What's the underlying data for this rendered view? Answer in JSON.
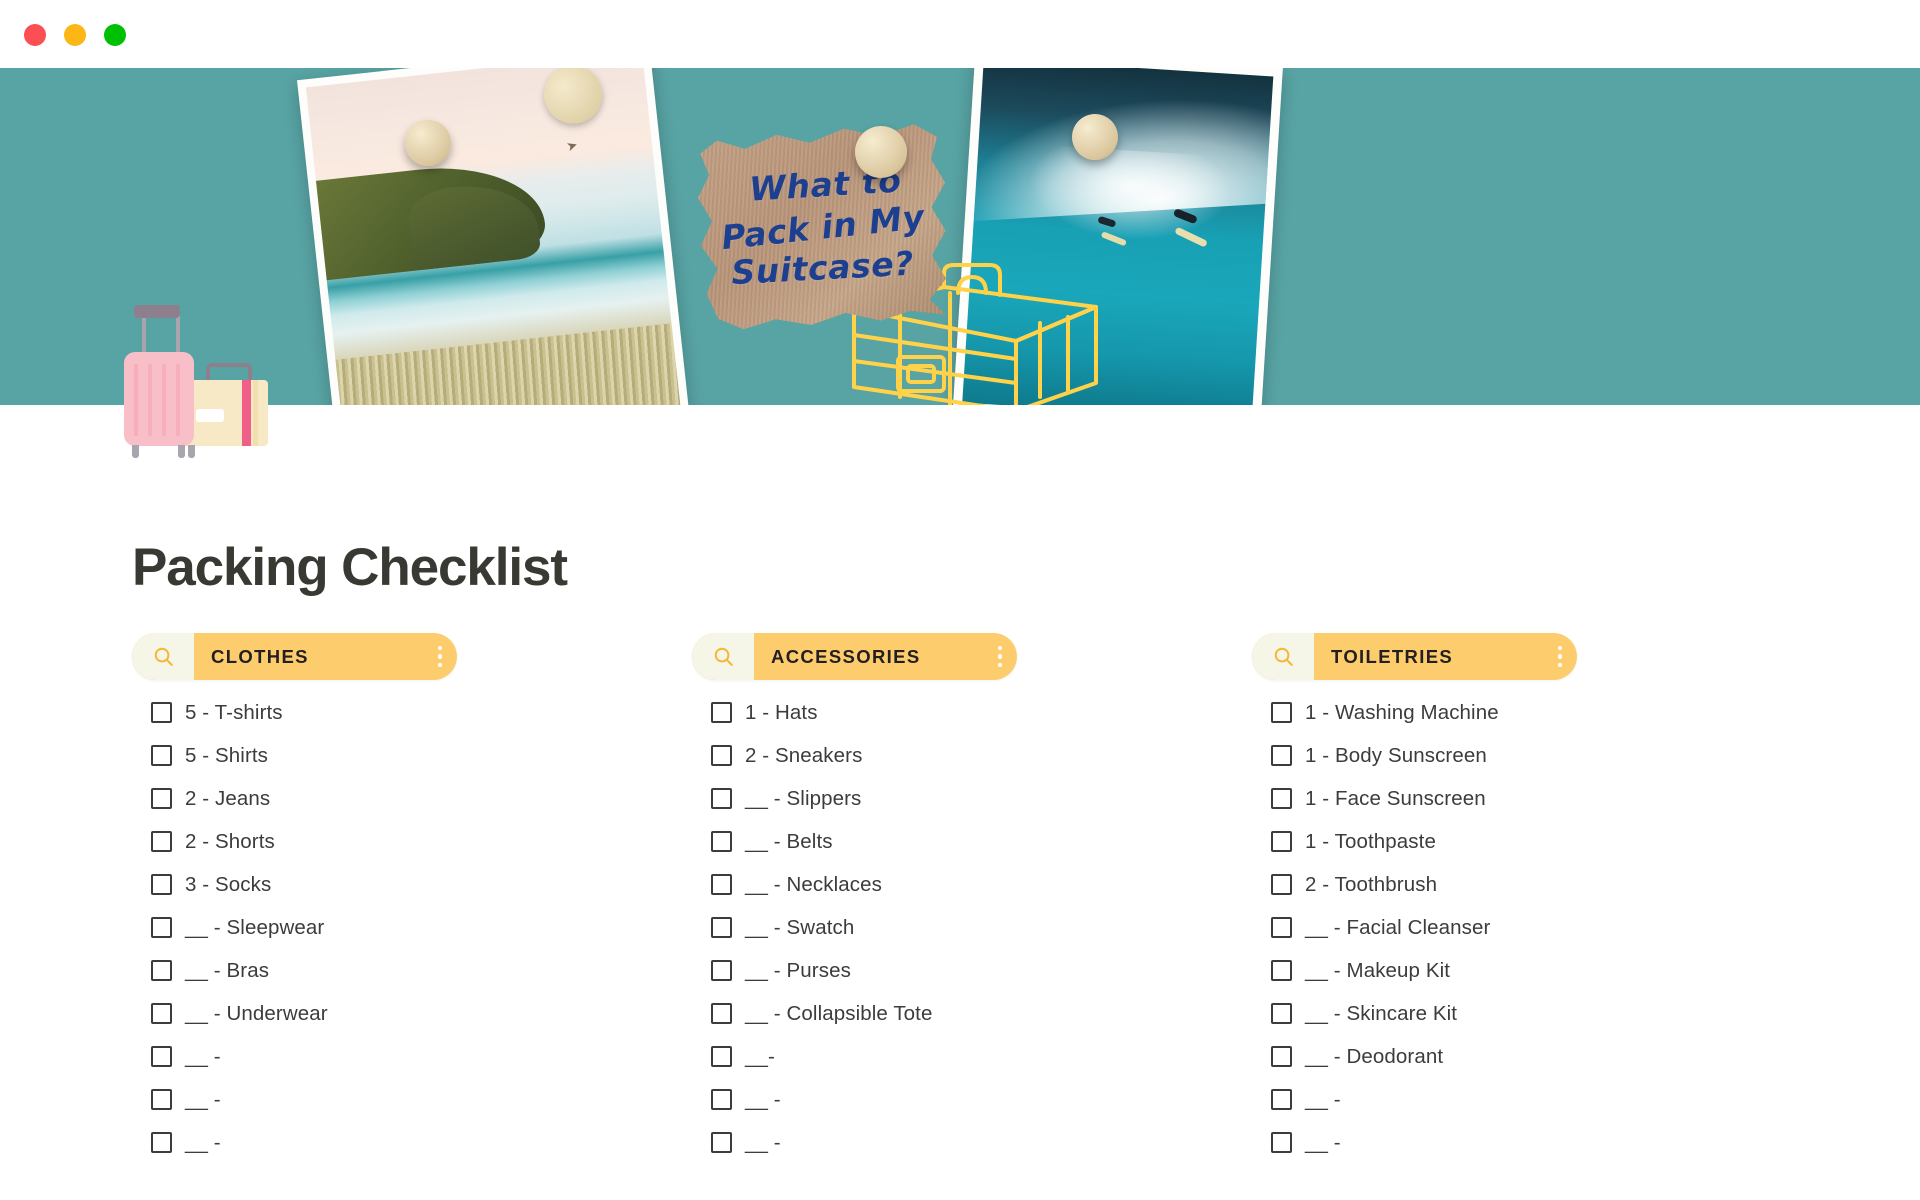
{
  "window": {
    "traffic_lights": [
      {
        "name": "close",
        "color": "#fc4f53"
      },
      {
        "name": "minimize",
        "color": "#fcb616"
      },
      {
        "name": "zoom",
        "color": "#01c001"
      }
    ]
  },
  "hero": {
    "background_color": "#58a3a4",
    "note_lines": [
      "What to",
      "Pack in My",
      "Suitcase?"
    ],
    "note_text": "What to Pack in My Suitcase?",
    "note_text_color": "#1c3f8f",
    "images": [
      {
        "name": "beach-photo",
        "description": "Coastal beach at sunset with headland"
      },
      {
        "name": "surf-photo",
        "description": "Surfers riding a large blue wave"
      }
    ],
    "illustrations": [
      "pink-suitcase",
      "cream-suitcase",
      "yellow-line-art-suitcase"
    ]
  },
  "page": {
    "title": "Packing Checklist",
    "title_color": "#393933"
  },
  "columns": [
    {
      "title": "Clothes",
      "accent_color": "#fdcd6d",
      "search_icon": "search-icon",
      "menu_icon": "kebab-menu-icon",
      "items": [
        {
          "qty": "5",
          "name": "T-shirts",
          "text": "5 - T-shirts",
          "checked": false
        },
        {
          "qty": "5",
          "name": "Shirts",
          "text": "5 - Shirts",
          "checked": false
        },
        {
          "qty": "2",
          "name": "Jeans",
          "text": "2 - Jeans",
          "checked": false
        },
        {
          "qty": "2",
          "name": "Shorts",
          "text": "2 - Shorts",
          "checked": false
        },
        {
          "qty": "3",
          "name": "Socks",
          "text": "3 - Socks",
          "checked": false
        },
        {
          "qty": "__",
          "name": "Sleepwear",
          "text": "__ - Sleepwear",
          "checked": false
        },
        {
          "qty": "__",
          "name": "Bras",
          "text": "__ - Bras",
          "checked": false
        },
        {
          "qty": "__",
          "name": "Underwear",
          "text": "__ - Underwear",
          "checked": false
        },
        {
          "qty": "__",
          "name": "",
          "text": "__ -",
          "checked": false
        },
        {
          "qty": "__",
          "name": "",
          "text": "__ -",
          "checked": false
        },
        {
          "qty": "__",
          "name": "",
          "text": "__ -",
          "checked": false
        }
      ]
    },
    {
      "title": "Accessories",
      "accent_color": "#fdcd6d",
      "search_icon": "search-icon",
      "menu_icon": "kebab-menu-icon",
      "items": [
        {
          "qty": "1",
          "name": "Hats",
          "text": "1 - Hats",
          "checked": false
        },
        {
          "qty": "2",
          "name": "Sneakers",
          "text": "2 - Sneakers",
          "checked": false
        },
        {
          "qty": "__",
          "name": "Slippers",
          "text": "__ - Slippers",
          "checked": false
        },
        {
          "qty": "__",
          "name": "Belts",
          "text": "__ - Belts",
          "checked": false
        },
        {
          "qty": "__",
          "name": "Necklaces",
          "text": "__ - Necklaces",
          "checked": false
        },
        {
          "qty": "__",
          "name": "Swatch",
          "text": "__ - Swatch",
          "checked": false
        },
        {
          "qty": "__",
          "name": "Purses",
          "text": "__ - Purses",
          "checked": false
        },
        {
          "qty": "__",
          "name": "Collapsible Tote",
          "text": "__ - Collapsible Tote",
          "checked": false
        },
        {
          "qty": "__",
          "name": "",
          "text": "__-",
          "checked": false
        },
        {
          "qty": "__",
          "name": "",
          "text": "__ -",
          "checked": false
        },
        {
          "qty": "__",
          "name": "",
          "text": "__ -",
          "checked": false
        }
      ]
    },
    {
      "title": "Toiletries",
      "accent_color": "#fdcd6d",
      "search_icon": "search-icon",
      "menu_icon": "kebab-menu-icon",
      "items": [
        {
          "qty": "1",
          "name": "Washing Machine",
          "text": "1 - Washing Machine",
          "checked": false
        },
        {
          "qty": "1",
          "name": "Body Sunscreen",
          "text": "1 - Body Sunscreen",
          "checked": false
        },
        {
          "qty": "1",
          "name": "Face Sunscreen",
          "text": "1 - Face Sunscreen",
          "checked": false
        },
        {
          "qty": "1",
          "name": "Toothpaste",
          "text": "1 - Toothpaste",
          "checked": false
        },
        {
          "qty": "2",
          "name": "Toothbrush",
          "text": "2 - Toothbrush",
          "checked": false
        },
        {
          "qty": "__",
          "name": "Facial Cleanser",
          "text": "__ - Facial Cleanser",
          "checked": false
        },
        {
          "qty": "__",
          "name": "Makeup Kit",
          "text": "__ - Makeup Kit",
          "checked": false
        },
        {
          "qty": "__",
          "name": "Skincare Kit",
          "text": "__ - Skincare Kit",
          "checked": false
        },
        {
          "qty": "__",
          "name": "Deodorant",
          "text": "__ - Deodorant",
          "checked": false
        },
        {
          "qty": "__",
          "name": "",
          "text": "__ -",
          "checked": false
        },
        {
          "qty": "__",
          "name": "",
          "text": "__ -",
          "checked": false
        }
      ]
    }
  ]
}
